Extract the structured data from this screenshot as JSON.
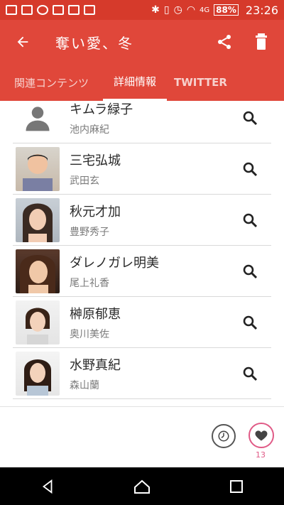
{
  "status_bar": {
    "battery": "88%",
    "signal": "4G",
    "time": "23:26"
  },
  "app_bar": {
    "title": "奪い愛、冬",
    "back_icon": "arrow-left-icon",
    "share_icon": "share-icon",
    "trash_icon": "trash-icon"
  },
  "tabs": [
    {
      "label": "関連コンテンツ"
    },
    {
      "label": "詳細情報"
    },
    {
      "label": "TWITTER"
    }
  ],
  "cast": [
    {
      "name": "キムラ緑子",
      "role": "池内麻紀",
      "avatar": "placeholder-person"
    },
    {
      "name": "三宅弘城",
      "role": "武田玄",
      "avatar": "photo"
    },
    {
      "name": "秋元才加",
      "role": "豊野秀子",
      "avatar": "photo"
    },
    {
      "name": "ダレノガレ明美",
      "role": "尾上礼香",
      "avatar": "photo"
    },
    {
      "name": "榊原郁恵",
      "role": "奥川美佐",
      "avatar": "photo"
    },
    {
      "name": "水野真紀",
      "role": "森山蘭",
      "avatar": "photo"
    }
  ],
  "bottom": {
    "like_count": "13"
  },
  "colors": {
    "primary": "#e0473a",
    "status": "#d63a2b",
    "accent": "#e05a86"
  }
}
